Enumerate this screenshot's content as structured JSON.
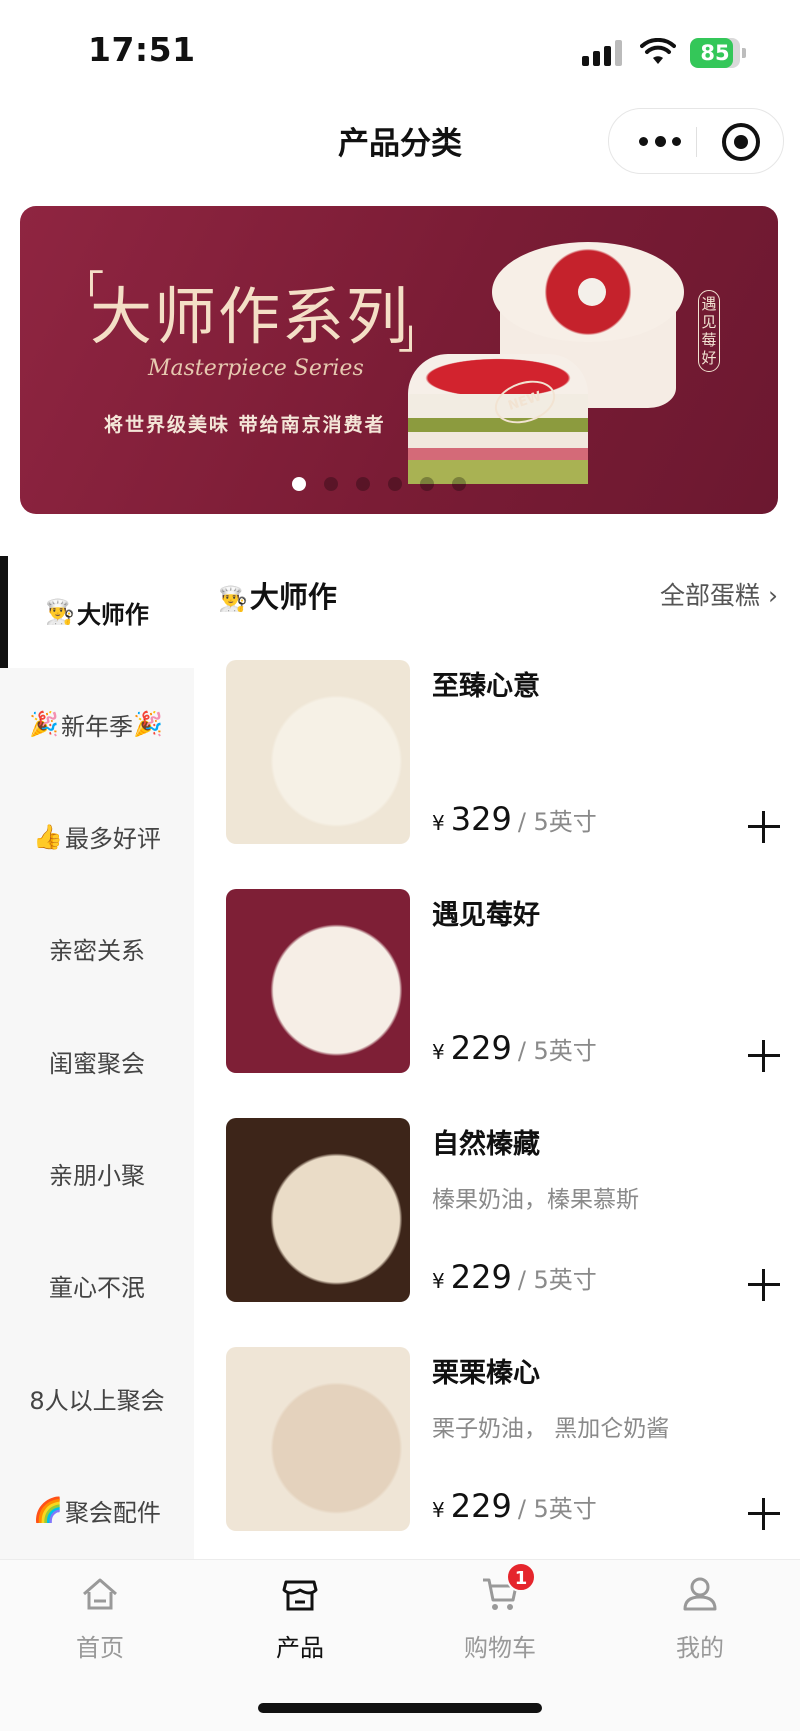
{
  "status": {
    "time": "17:51",
    "battery": "85"
  },
  "nav": {
    "title": "产品分类"
  },
  "banner": {
    "title": "大师作系列",
    "script": "Masterpiece Series",
    "subtitle": "将世界级美味  带给南京消费者",
    "tag": "NEW",
    "vertical_label": "遇见莓好",
    "slides": 6,
    "active_slide": 1
  },
  "sidebar": {
    "items": [
      {
        "emoji": "👨‍🍳",
        "label": "大师作",
        "active": true
      },
      {
        "emoji": "🎉",
        "label": "新年季",
        "emoji_after": "🎉"
      },
      {
        "emoji": "👍",
        "label": "最多好评"
      },
      {
        "label": "亲密关系"
      },
      {
        "label": "闺蜜聚会"
      },
      {
        "label": "亲朋小聚"
      },
      {
        "label": "童心不泯"
      },
      {
        "label": "8人以上聚会"
      },
      {
        "emoji": "🌈",
        "label": "聚会配件"
      }
    ]
  },
  "section": {
    "emoji": "👨‍🍳",
    "title": "大师作",
    "link": "全部蛋糕 ›"
  },
  "products": [
    {
      "name": "至臻心意",
      "desc": "",
      "currency": "¥",
      "price": "329",
      "unit": "/ 5英寸",
      "colors": [
        "#efe6d6",
        "#f6f1e6"
      ]
    },
    {
      "name": "遇见莓好",
      "desc": "",
      "currency": "¥",
      "price": "229",
      "unit": "/ 5英寸",
      "colors": [
        "#7e1f36",
        "#f6eee6"
      ]
    },
    {
      "name": "自然榛藏",
      "desc": "榛果奶油，榛果慕斯",
      "currency": "¥",
      "price": "229",
      "unit": "/ 5英寸",
      "colors": [
        "#3d2519",
        "#eadcc7"
      ]
    },
    {
      "name": "栗栗榛心",
      "desc": "栗子奶油， 黑加仑奶酱",
      "currency": "¥",
      "price": "229",
      "unit": "/ 5英寸",
      "colors": [
        "#efe5d6",
        "#e4d2bd"
      ]
    }
  ],
  "tabbar": {
    "tabs": [
      {
        "label": "首页",
        "icon": "home-icon"
      },
      {
        "label": "产品",
        "icon": "store-icon",
        "active": true
      },
      {
        "label": "购物车",
        "icon": "cart-icon",
        "badge": "1"
      },
      {
        "label": "我的",
        "icon": "user-icon"
      }
    ]
  }
}
